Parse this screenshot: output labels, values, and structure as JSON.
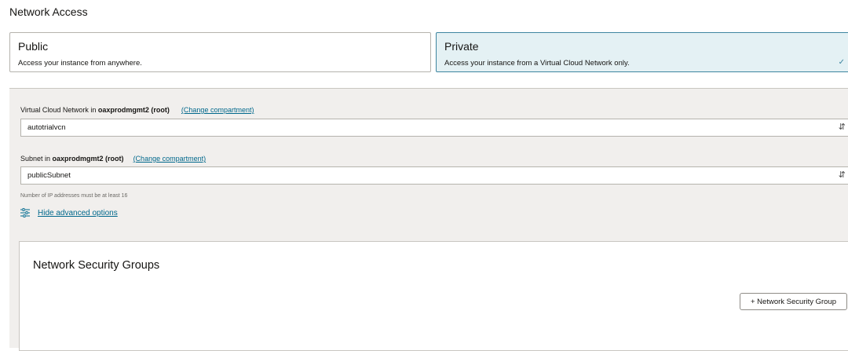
{
  "section": {
    "title": "Network Access"
  },
  "options": {
    "public": {
      "title": "Public",
      "description": "Access your instance from anywhere."
    },
    "private": {
      "title": "Private",
      "description": "Access your instance from a Virtual Cloud Network only.",
      "check_mark": "✓"
    }
  },
  "vcn": {
    "label_prefix": "Virtual Cloud Network in ",
    "compartment": "oaxprodmgmt2 (root)",
    "change_link": "(Change compartment)",
    "value": "autotrialvcn"
  },
  "subnet": {
    "label_prefix": "Subnet in ",
    "compartment": "oaxprodmgmt2 (root)",
    "change_link": "(Change compartment)",
    "value": "publicSubnet",
    "hint": "Number of IP addresses must be at least 16"
  },
  "advanced": {
    "toggle_label": "Hide advanced options",
    "icon": "sliders-icon"
  },
  "nsg": {
    "title": "Network Security Groups",
    "add_button": "+ Network Security Group"
  },
  "colors": {
    "accent": "#00688c",
    "selected_bg": "#e4f1f4",
    "panel_bg": "#f1efed"
  }
}
